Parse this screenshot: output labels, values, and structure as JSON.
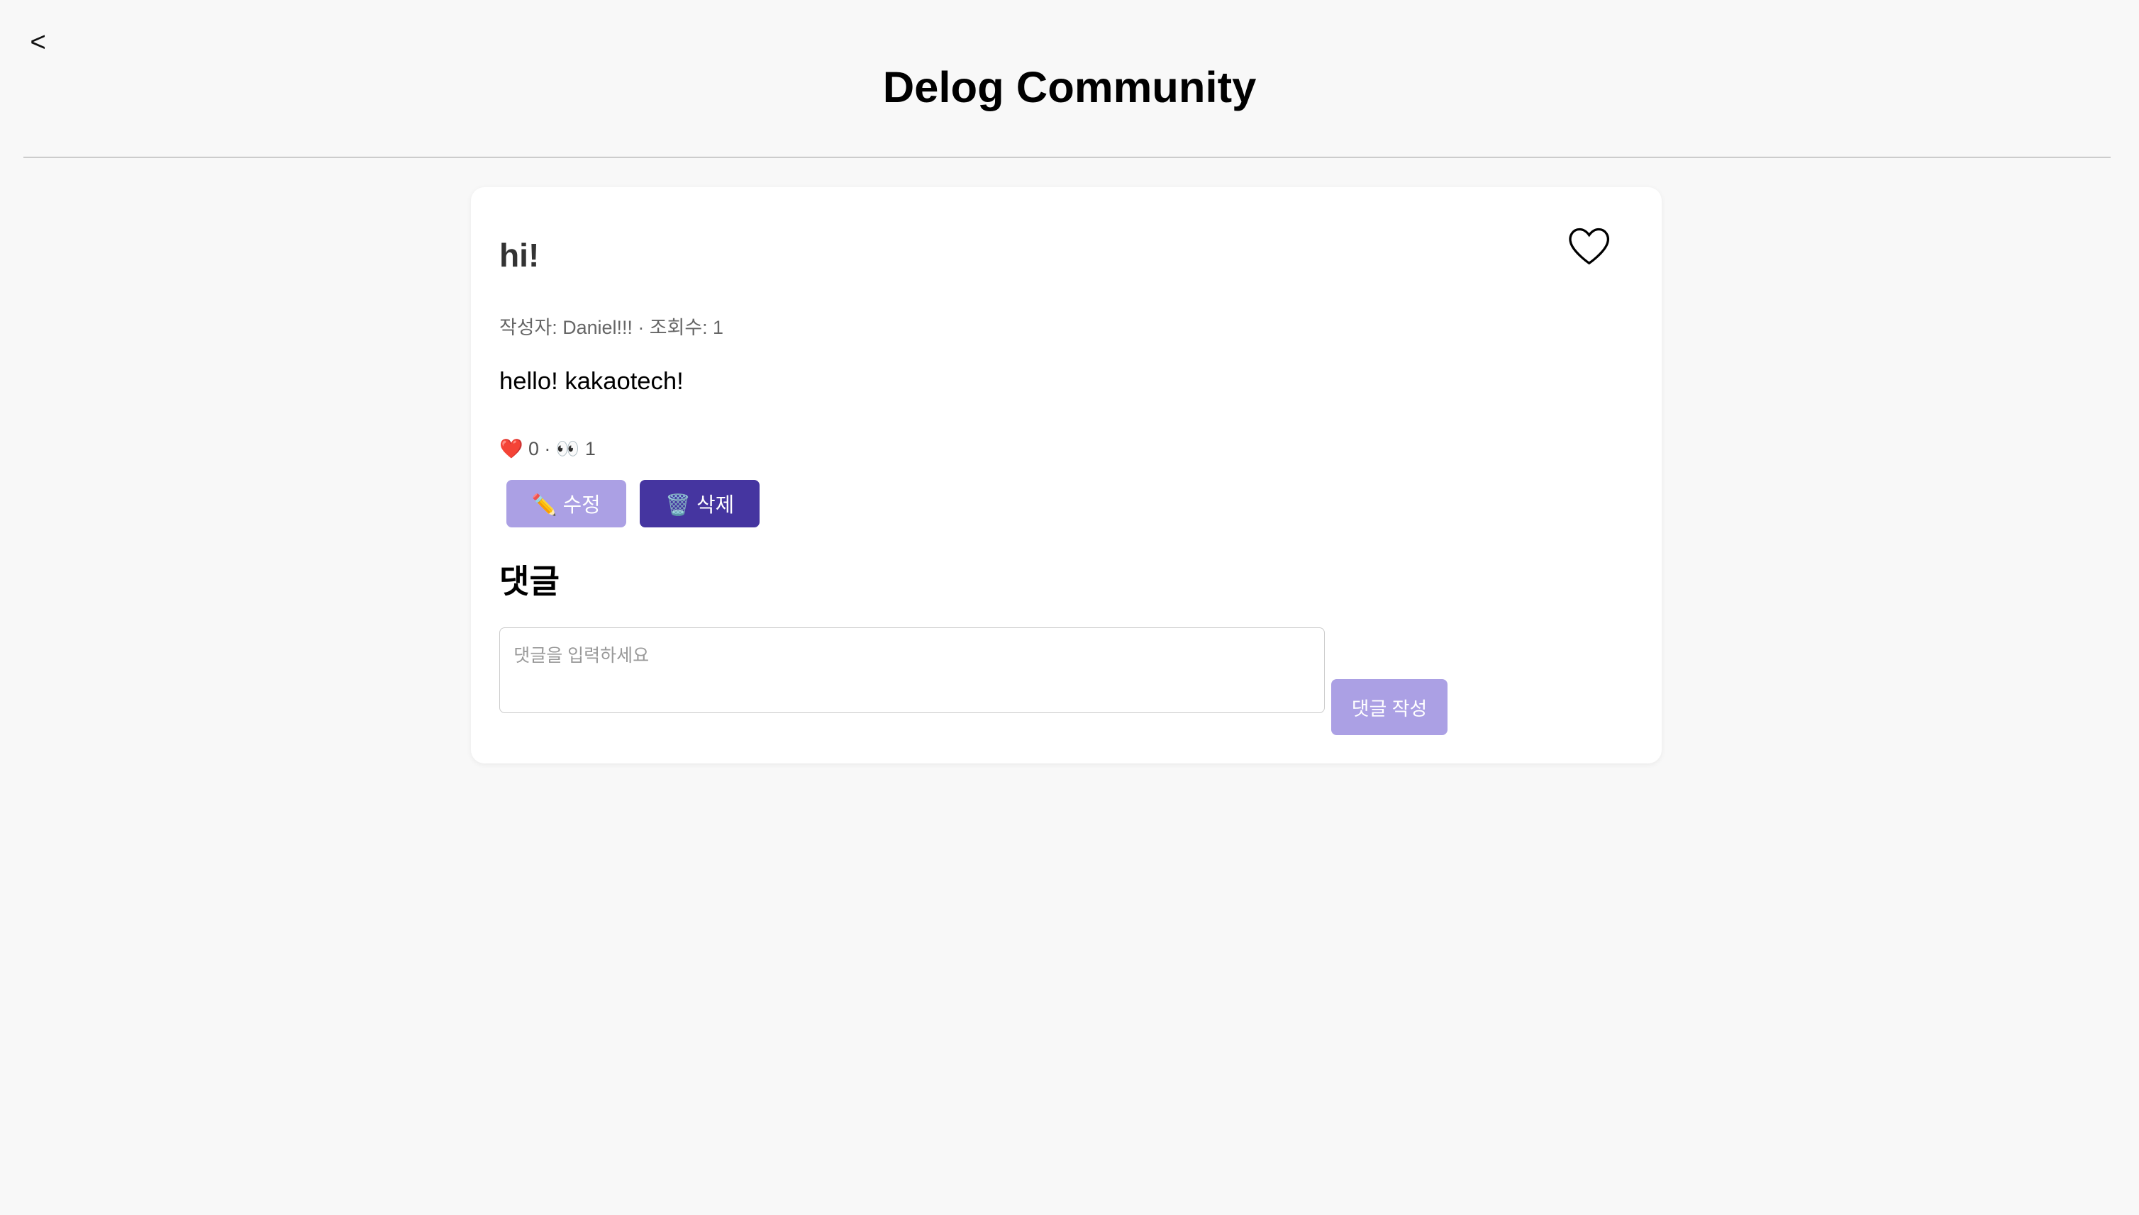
{
  "header": {
    "back_label": "<",
    "title": "Delog Community"
  },
  "post": {
    "title": "hi!",
    "meta": "작성자: Daniel!!! · 조회수: 1",
    "content": "hello! kakaotech!",
    "stats": "❤️ 0 · 👀 1",
    "edit_label": "✏️ 수정",
    "delete_label": "🗑️ 삭제"
  },
  "comments": {
    "heading": "댓글",
    "placeholder": "댓글을 입력하세요",
    "submit_label": "댓글 작성"
  },
  "colors": {
    "primary_light": "#aba0e4",
    "primary_dark": "#4535a0"
  }
}
